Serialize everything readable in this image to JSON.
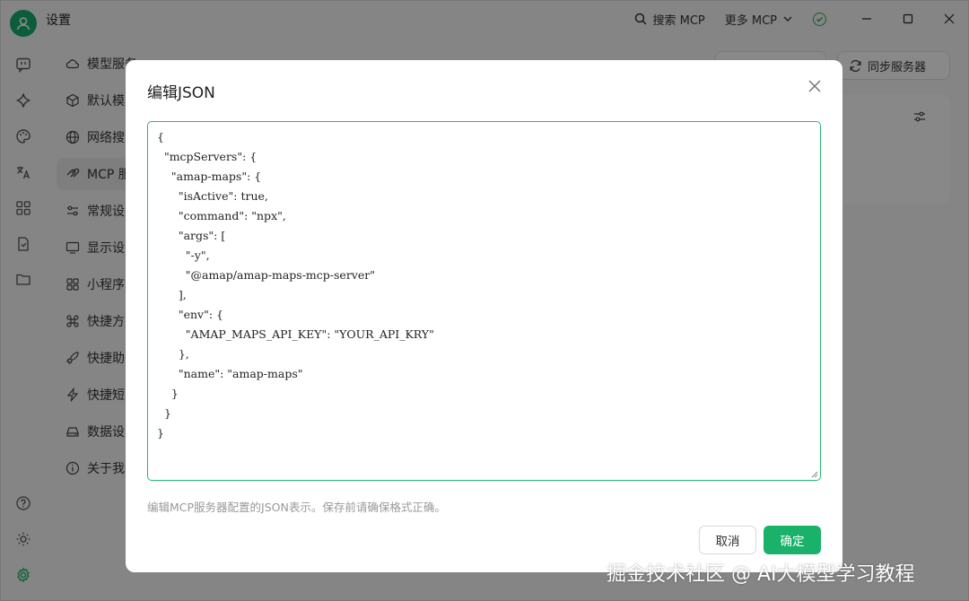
{
  "app": {
    "title": "设置"
  },
  "titlebar": {
    "search_mcp": "搜索 MCP",
    "more_mcp": "更多 MCP"
  },
  "nav": {
    "items": [
      {
        "label": "模型服务",
        "icon": "cloud-icon"
      },
      {
        "label": "默认模",
        "icon": "cube-icon"
      },
      {
        "label": "网络搜",
        "icon": "globe-icon"
      },
      {
        "label": "MCP 服",
        "icon": "mcp-icon",
        "active": true
      },
      {
        "label": "常规设",
        "icon": "sliders-icon"
      },
      {
        "label": "显示设",
        "icon": "monitor-icon"
      },
      {
        "label": "小程序",
        "icon": "grid-icon"
      },
      {
        "label": "快捷方",
        "icon": "command-icon"
      },
      {
        "label": "快捷助",
        "icon": "rocket-icon"
      },
      {
        "label": "快捷短",
        "icon": "bolt-icon"
      },
      {
        "label": "数据设",
        "icon": "drive-icon"
      },
      {
        "label": "关于我",
        "icon": "info-icon"
      }
    ]
  },
  "content": {
    "sync_servers": "同步服务器"
  },
  "modal": {
    "title": "编辑JSON",
    "json_text": "{\n  \"mcpServers\": {\n    \"amap-maps\": {\n      \"isActive\": true,\n      \"command\": \"npx\",\n      \"args\": [\n        \"-y\",\n        \"@amap/amap-maps-mcp-server\"\n      ],\n      \"env\": {\n        \"AMAP_MAPS_API_KEY\": \"YOUR_API_KRY\"\n      },\n      \"name\": \"amap-maps\"\n    }\n  }\n}",
    "hint": "编辑MCP服务器配置的JSON表示。保存前请确保格式正确。",
    "cancel": "取消",
    "confirm": "确定"
  },
  "watermark": "掘金技术社区 @ AI大模型学习教程",
  "colors": {
    "accent": "#1ab26b",
    "editor_border": "#26b870"
  }
}
